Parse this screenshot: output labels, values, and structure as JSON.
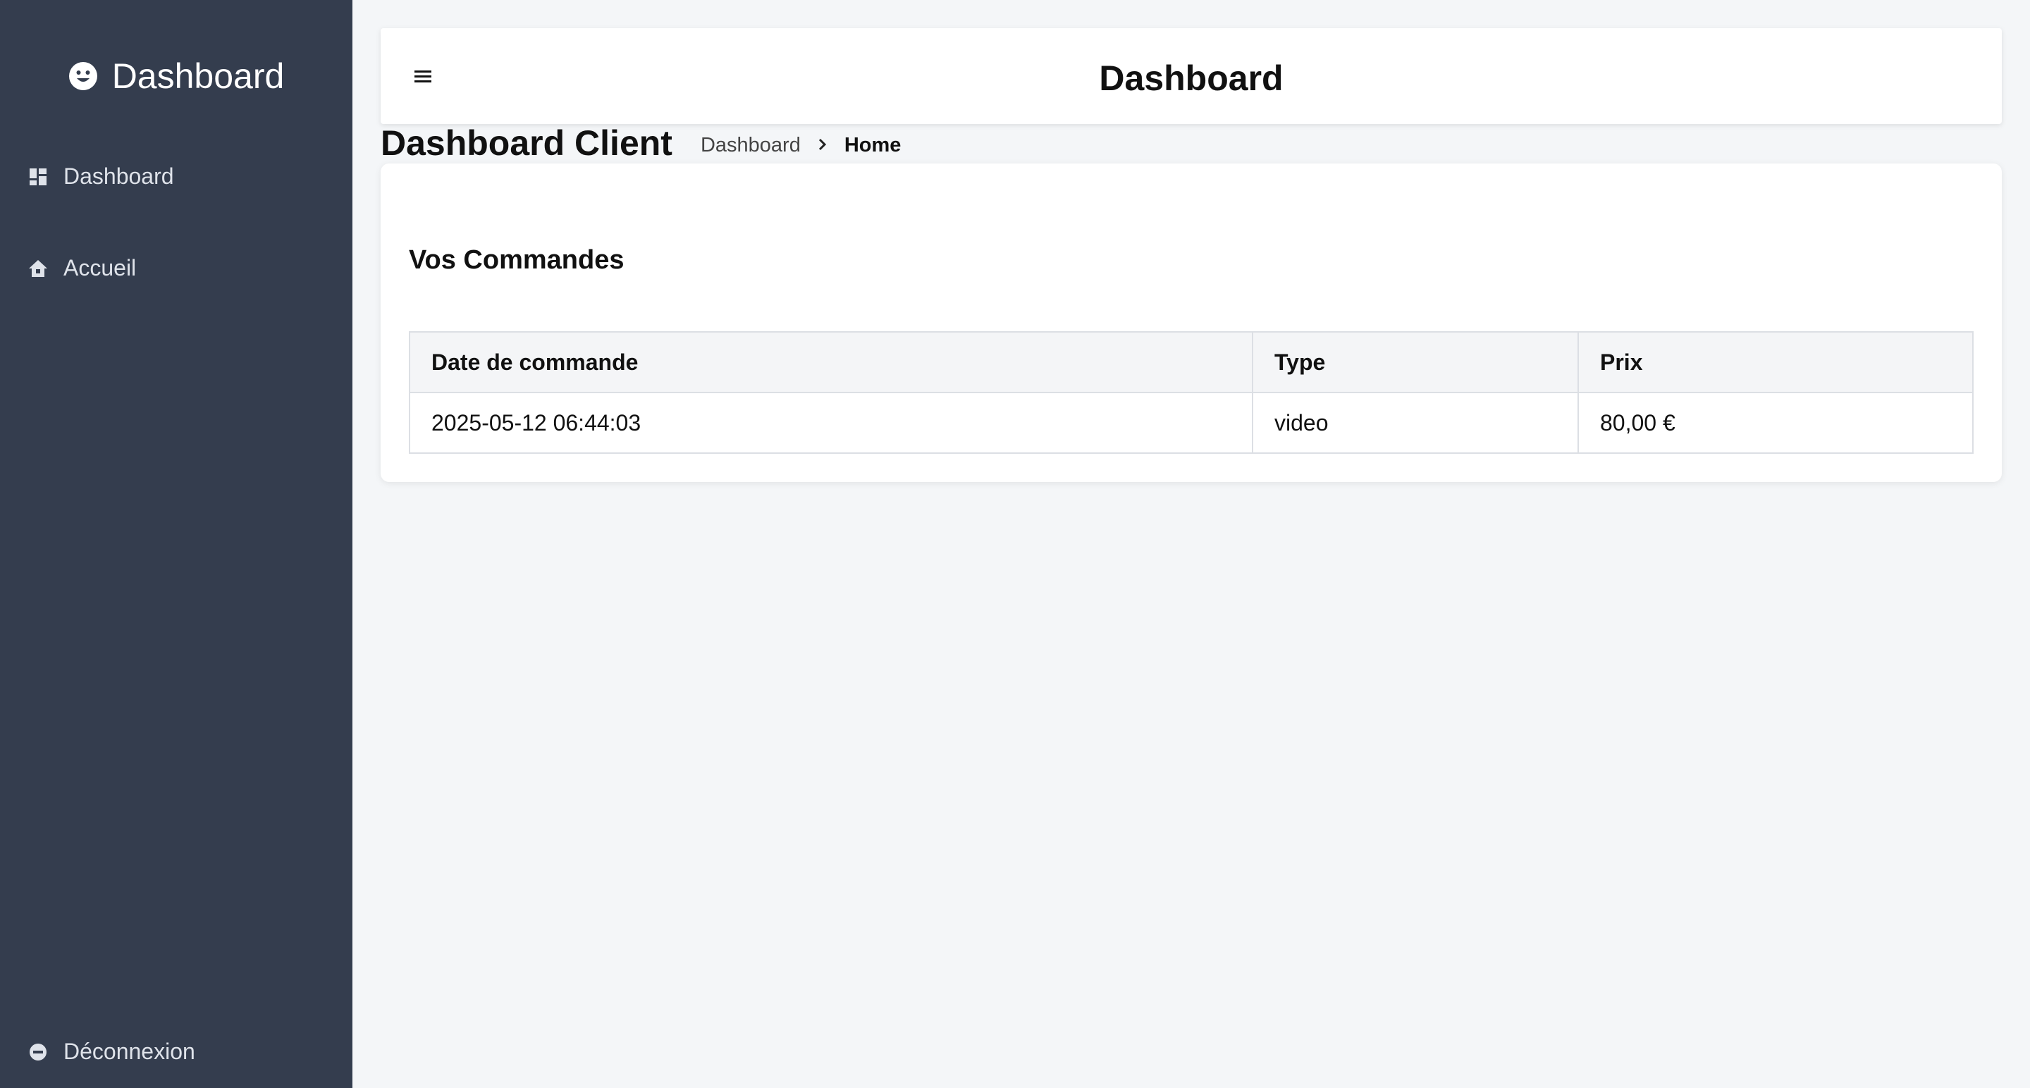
{
  "sidebar": {
    "brand": {
      "icon": "smiley-icon",
      "title": "Dashboard"
    },
    "items": [
      {
        "icon": "grid-icon",
        "label": "Dashboard"
      },
      {
        "icon": "home-icon",
        "label": "Accueil"
      }
    ],
    "logout": {
      "icon": "logout-icon",
      "label": "Déconnexion"
    }
  },
  "header": {
    "menu_icon": "hamburger-icon",
    "title": "Dashboard"
  },
  "page": {
    "title": "Dashboard Client",
    "breadcrumb": {
      "items": [
        "Dashboard"
      ],
      "current": "Home"
    }
  },
  "orders": {
    "title": "Vos Commandes",
    "columns": [
      "Date de commande",
      "Type",
      "Prix"
    ],
    "rows": [
      [
        "2025-05-12 06:44:03",
        "video",
        "80,00 €"
      ]
    ]
  },
  "colors": {
    "sidebar_bg": "#343d4e",
    "page_bg": "#f4f6f8",
    "card_bg": "#ffffff"
  }
}
